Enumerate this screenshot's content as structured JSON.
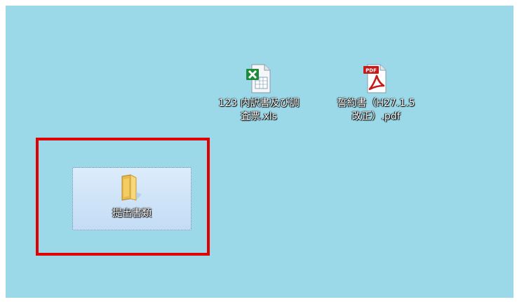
{
  "desktop": {
    "background_color": "#9bd9e8",
    "icons": [
      {
        "name": "excel-file",
        "icon": "excel-icon",
        "label": "123 内訳書及び調\n査票.xls"
      },
      {
        "name": "pdf-file",
        "icon": "pdf-icon",
        "label": "誓約書（H27.1.5\n改正）.pdf",
        "badge": "PDF"
      },
      {
        "name": "folder",
        "icon": "folder-icon",
        "label": "提出書類",
        "selected": true
      }
    ]
  },
  "annotation": {
    "highlight_color": "#e00000"
  }
}
